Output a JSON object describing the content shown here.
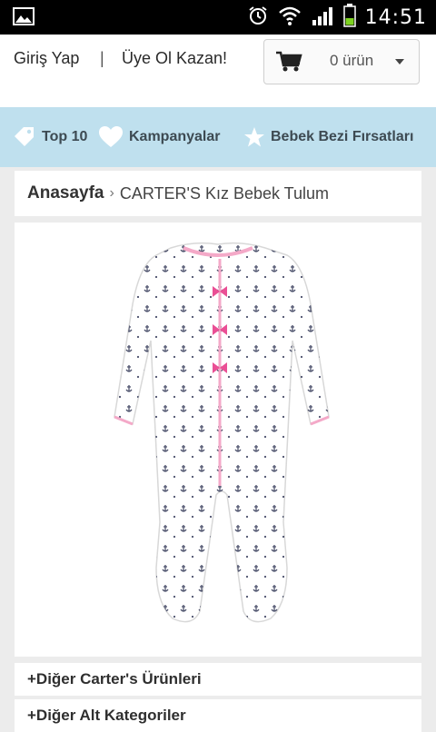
{
  "status_bar": {
    "time": "14:51",
    "icons": [
      "image-icon",
      "alarm-icon",
      "wifi-icon",
      "signal-icon",
      "battery-icon"
    ]
  },
  "header": {
    "login_label": "Giriş Yap",
    "separator": "|",
    "signup_label": "Üye Ol Kazan!",
    "cart_label": "0 ürün"
  },
  "nav": {
    "items": [
      {
        "label": "Top 10",
        "icon": "tag-icon"
      },
      {
        "label": "Kampanyalar",
        "icon": "heart-icon"
      },
      {
        "label": "Bebek Bezi Fırsatları",
        "icon": "star-icon"
      }
    ]
  },
  "breadcrumb": {
    "home": "Anasayfa",
    "separator": "›",
    "current": "CARTER'S Kız Bebek Tulum"
  },
  "sections": {
    "other_products": "+Diğer Carter's Ürünleri",
    "sub_categories": "+Diğer Alt Kategoriler"
  },
  "colors": {
    "nav_bg": "#bfe0ee",
    "page_bg": "#ececec",
    "bow_pink": "#ea4f95"
  }
}
